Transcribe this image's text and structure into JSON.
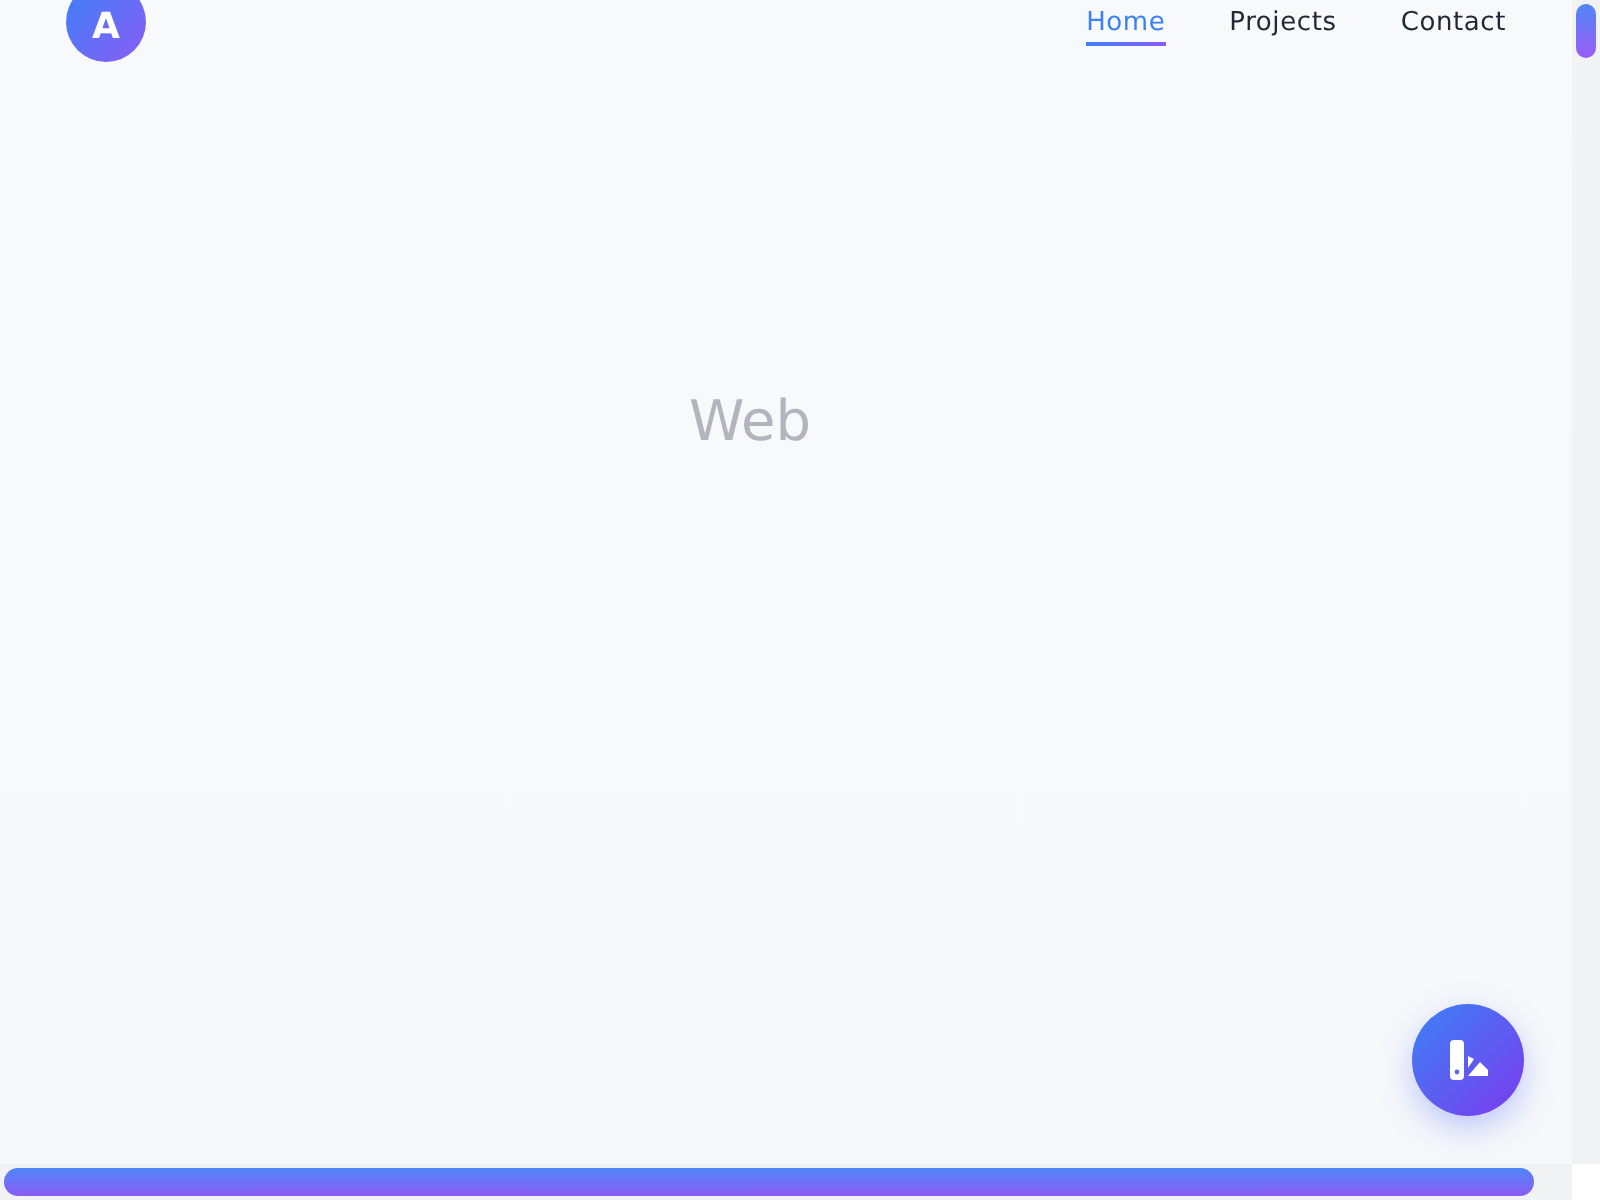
{
  "logo": {
    "letter": "A"
  },
  "nav": [
    {
      "label": "Home",
      "selected": true
    },
    {
      "label": "Projects",
      "selected": false
    },
    {
      "label": "Contact",
      "selected": false
    }
  ],
  "hero": {
    "text": "Web"
  }
}
